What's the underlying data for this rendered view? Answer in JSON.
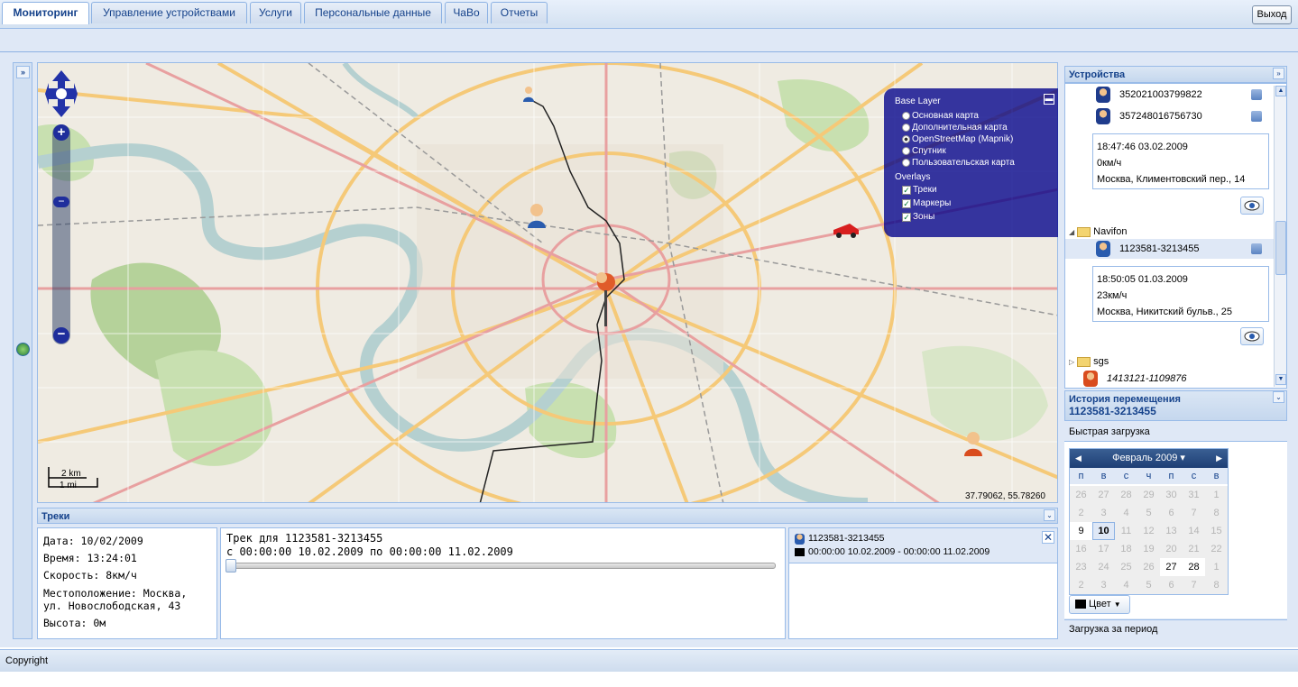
{
  "header": {
    "logout_label": "Выход"
  },
  "tabs": [
    {
      "label": "Мониторинг",
      "active": true
    },
    {
      "label": "Управление устройствами"
    },
    {
      "label": "Услуги"
    },
    {
      "label": "Персональные данные"
    },
    {
      "label": "ЧаВо"
    },
    {
      "label": "Отчеты"
    }
  ],
  "map": {
    "layer_switcher": {
      "base_title": "Base Layer",
      "base_layers": [
        {
          "label": "Основная карта",
          "selected": false
        },
        {
          "label": "Дополнительная карта",
          "selected": false
        },
        {
          "label": "OpenStreetMap (Mapnik)",
          "selected": true
        },
        {
          "label": "Спутник",
          "selected": false
        },
        {
          "label": "Пользовательская карта",
          "selected": false
        }
      ],
      "overlays_title": "Overlays",
      "overlays": [
        {
          "label": "Треки",
          "checked": true
        },
        {
          "label": "Маркеры",
          "checked": true
        },
        {
          "label": "Зоны",
          "checked": true
        }
      ]
    },
    "scale_km": "2 km",
    "scale_mi": "1 mi",
    "coordinates": "37.79062, 55.78260"
  },
  "tracks": {
    "title": "Треки",
    "info": {
      "date": "Дата: 10/02/2009",
      "time": "Время: 13:24:01",
      "speed": "Скорость: 8км/ч",
      "location1": "Местоположение: Москва,",
      "location2": "ул. Новослободская, 43",
      "altitude": "Высота: 0м"
    },
    "track_title": "Трек для 1123581-3213455",
    "track_range": "с 00:00:00 10.02.2009 по 00:00:00 11.02.2009",
    "list": {
      "device": "1123581-3213455",
      "range": "00:00:00 10.02.2009 - 00:00:00 11.02.2009"
    }
  },
  "devices": {
    "title": "Устройства",
    "items": [
      {
        "id": "352021003799822"
      },
      {
        "id": "357248016756730"
      }
    ],
    "card1": {
      "time": "18:47:46 03.02.2009",
      "speed": "0км/ч",
      "address": "Москва, Климентовский пер., 14"
    },
    "group_navifon": "Navifon",
    "navifon_device": "1123581-3213455",
    "card2": {
      "time": "18:50:05 01.03.2009",
      "speed": "23км/ч",
      "address": "Москва, Никитский бульв., 25"
    },
    "group_sgs": "sgs",
    "sgs_device": "1413121-1109876"
  },
  "history": {
    "title": "История перемещения",
    "device": "1123581-3213455",
    "quick_load": "Быстрая загрузка",
    "period_load": "Загрузка за период",
    "color_label": "Цвет"
  },
  "calendar": {
    "month_label": "Февраль 2009",
    "dow": [
      "п",
      "в",
      "с",
      "ч",
      "п",
      "с",
      "в"
    ],
    "weeks": [
      [
        "26",
        "27",
        "28",
        "29",
        "30",
        "31",
        "1"
      ],
      [
        "2",
        "3",
        "4",
        "5",
        "6",
        "7",
        "8"
      ],
      [
        "9",
        "10",
        "11",
        "12",
        "13",
        "14",
        "15"
      ],
      [
        "16",
        "17",
        "18",
        "19",
        "20",
        "21",
        "22"
      ],
      [
        "23",
        "24",
        "25",
        "26",
        "27",
        "28",
        "1"
      ],
      [
        "2",
        "3",
        "4",
        "5",
        "6",
        "7",
        "8"
      ]
    ],
    "today": "10"
  },
  "footer": {
    "copyright": "Copyright"
  },
  "colors": {
    "accent": "#15428b",
    "panel_bg": "#dfe8f6",
    "border": "#99bbe8",
    "layer_bg": "#00008b"
  }
}
